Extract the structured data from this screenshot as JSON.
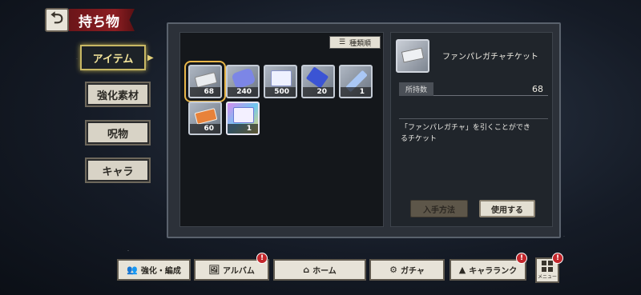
{
  "header": {
    "title": "持ち物",
    "back_icon": "back-arrow-icon"
  },
  "tabs": [
    {
      "label": "アイテム",
      "active": true
    },
    {
      "label": "強化素材",
      "active": false
    },
    {
      "label": "呪物",
      "active": false
    },
    {
      "label": "キャラ",
      "active": false
    }
  ],
  "sort": {
    "label": "種類順",
    "icon": "sort-icon"
  },
  "items": [
    {
      "qty": "68",
      "icon": "ticket-icon",
      "selected": true,
      "color": "#e9ecef"
    },
    {
      "qty": "240",
      "icon": "crystal-bag-icon",
      "selected": false,
      "color": "#7c86e6"
    },
    {
      "qty": "500",
      "icon": "dice-icon",
      "selected": false,
      "color": "#eef1ff"
    },
    {
      "qty": "20",
      "icon": "blue-crystal-icon",
      "selected": false,
      "color": "#3b54d4"
    },
    {
      "qty": "1",
      "icon": "vial-icon",
      "selected": false,
      "color": "#a9c7f5"
    },
    {
      "qty": "60",
      "icon": "orange-ticket-icon",
      "selected": false,
      "color": "#e8823a"
    },
    {
      "qty": "1",
      "icon": "rainbow-ticket-icon",
      "selected": false,
      "color": "#f3f0ff"
    }
  ],
  "detail": {
    "name": "ファンパレガチャチケット",
    "owned_label": "所持数",
    "owned_value": "68",
    "description_line1": "「ファンパレガチャ」を引くことができ",
    "description_line2": "るチケット",
    "acquire_label": "入手方法",
    "use_label": "使用する"
  },
  "nav": [
    {
      "label": "強化・編成",
      "icon": "group-icon",
      "badge": ""
    },
    {
      "label": "アルバム",
      "icon": "album-icon",
      "badge": "!"
    },
    {
      "label": "ホーム",
      "icon": "home-icon",
      "badge": ""
    },
    {
      "label": "ガチャ",
      "icon": "gacha-icon",
      "badge": ""
    },
    {
      "label": "キャラランク",
      "icon": "rank-icon",
      "badge": "!"
    }
  ],
  "menu": {
    "label": "メニュー",
    "badge": "!"
  }
}
